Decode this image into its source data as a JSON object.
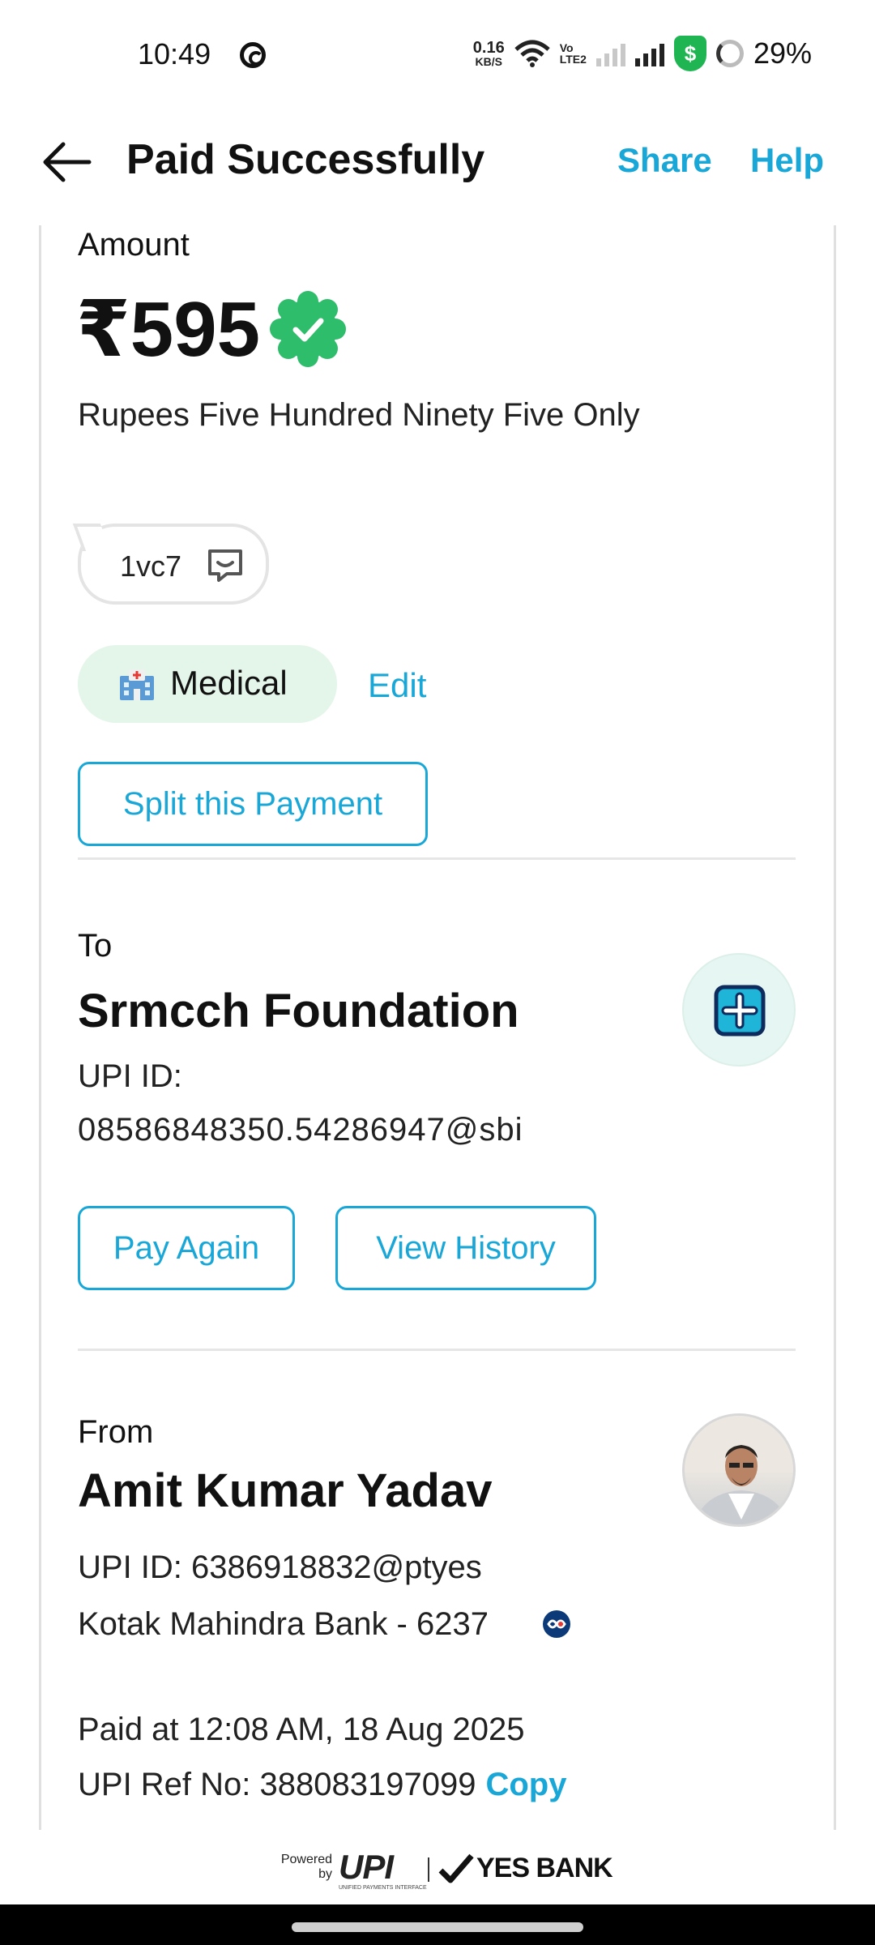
{
  "status_bar": {
    "time": "10:49",
    "net_speed_value": "0.16",
    "net_speed_unit": "KB/S",
    "volte_top": "Vo",
    "volte_bottom": "LTE2",
    "battery": "29%"
  },
  "header": {
    "title": "Paid Successfully",
    "share": "Share",
    "help": "Help"
  },
  "amount": {
    "label": "Amount",
    "value": "₹595",
    "in_words": "Rupees Five Hundred Ninety Five Only",
    "note": "1vc7",
    "category": "Medical",
    "edit": "Edit",
    "split_button": "Split this Payment"
  },
  "to": {
    "label": "To",
    "name": "Srmcch Foundation",
    "upi_label": "UPI ID:",
    "upi_value": "08586848350.54286947@sbi",
    "pay_again": "Pay Again",
    "view_history": "View History"
  },
  "from": {
    "label": "From",
    "name": "Amit Kumar Yadav",
    "upi": "UPI ID: 6386918832@ptyes",
    "bank": "Kotak Mahindra Bank - 6237"
  },
  "details": {
    "paid_at": "Paid at 12:08 AM, 18 Aug 2025",
    "ref": "UPI Ref No: 388083197099",
    "copy": "Copy"
  },
  "footer": {
    "powered": "Powered",
    "by": "by",
    "upi": "UPI",
    "upi_sub": "UNIFIED PAYMENTS INTERFACE",
    "bank": "YES BANK"
  },
  "colors": {
    "accent": "#19a7d8",
    "success": "#2ebd6b",
    "chip_bg": "#e4f5ea"
  }
}
